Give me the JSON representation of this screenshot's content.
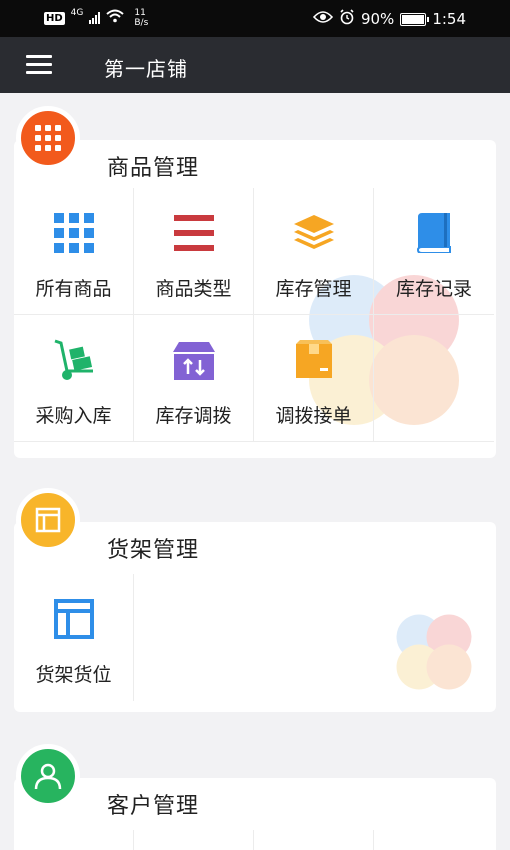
{
  "status_bar": {
    "hd": "HD",
    "network": "4G",
    "speed_value": "11",
    "speed_unit": "B/s",
    "battery": "90%",
    "time": "1:54"
  },
  "toolbar": {
    "title": "第一店铺"
  },
  "sections": [
    {
      "title": "商品管理",
      "items": [
        {
          "label": "所有商品",
          "icon": "grid-icon"
        },
        {
          "label": "商品类型",
          "icon": "list-lines-icon"
        },
        {
          "label": "库存管理",
          "icon": "stack-layers-icon"
        },
        {
          "label": "库存记录",
          "icon": "book-icon"
        },
        {
          "label": "采购入库",
          "icon": "hand-truck-icon"
        },
        {
          "label": "库存调拨",
          "icon": "transfer-box-icon"
        },
        {
          "label": "调拨接单",
          "icon": "package-box-icon"
        }
      ]
    },
    {
      "title": "货架管理",
      "items": [
        {
          "label": "货架货位",
          "icon": "shelf-layout-icon"
        }
      ]
    },
    {
      "title": "客户管理",
      "items": []
    }
  ],
  "colors": {
    "status_bar": "#0b0b0b",
    "toolbar": "#2a2c31",
    "goods_badge": "#f25a1c",
    "shelf_badge": "#f8b52a",
    "customer_badge": "#27b45f",
    "icon_blue": "#2e8ee8",
    "icon_red": "#c93a3e",
    "icon_orange": "#f6a623",
    "icon_green": "#1fb36a",
    "icon_purple": "#8262d4"
  }
}
